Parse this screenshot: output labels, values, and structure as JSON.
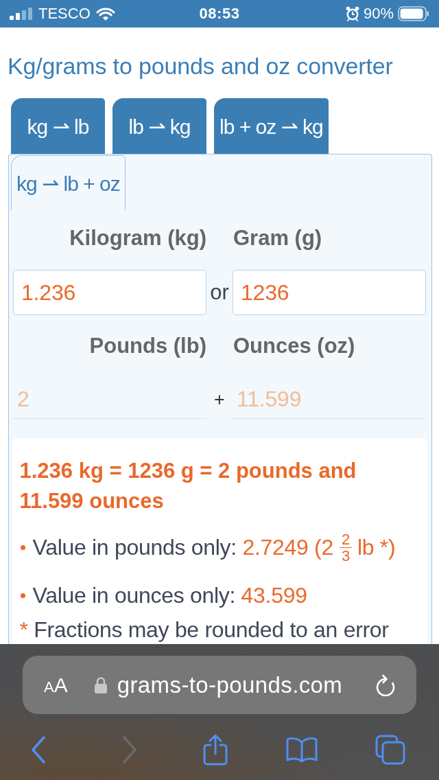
{
  "status_bar": {
    "carrier": "TESCO",
    "time": "08:53",
    "battery": "90%"
  },
  "title": "Kg/grams to pounds and oz converter",
  "tabs": [
    {
      "label": "kg ⇀ lb",
      "selected": false
    },
    {
      "label": "lb ⇀ kg",
      "selected": false
    },
    {
      "label": "lb + oz ⇀ kg",
      "selected": false
    },
    {
      "label": "kg ⇀ lb + oz",
      "selected": true
    }
  ],
  "form": {
    "inputs": [
      {
        "label": "Kilogram (kg)",
        "value": "1.236"
      },
      {
        "label": "Gram (g)",
        "value": "1236"
      }
    ],
    "inputs_separator": "or",
    "outputs": [
      {
        "label": "Pounds (lb)",
        "value": "2"
      },
      {
        "label": "Ounces (oz)",
        "value": "11.599"
      }
    ],
    "outputs_separator": "+"
  },
  "result": {
    "summary": "1.236 kg = 1236 g = 2 pounds and 11.599 ounces",
    "items": [
      {
        "label": "Value in pounds only:",
        "value": "2.7249 (2",
        "fraction": {
          "numerator": "2",
          "denominator": "3"
        },
        "suffix": "lb *)"
      },
      {
        "label": "Value in ounces only:",
        "value": "43.599"
      }
    ],
    "footnote": {
      "mark": "*",
      "text": "Fractions may be rounded to an error"
    }
  },
  "browser": {
    "text_size_button": "AA",
    "url": "grams-to-pounds.com",
    "toolbar": [
      {
        "kind": "back",
        "disabled": false
      },
      {
        "kind": "forward",
        "disabled": true
      },
      {
        "kind": "share",
        "disabled": false
      },
      {
        "kind": "bookmarks",
        "disabled": false
      },
      {
        "kind": "tabs",
        "disabled": false
      }
    ]
  }
}
